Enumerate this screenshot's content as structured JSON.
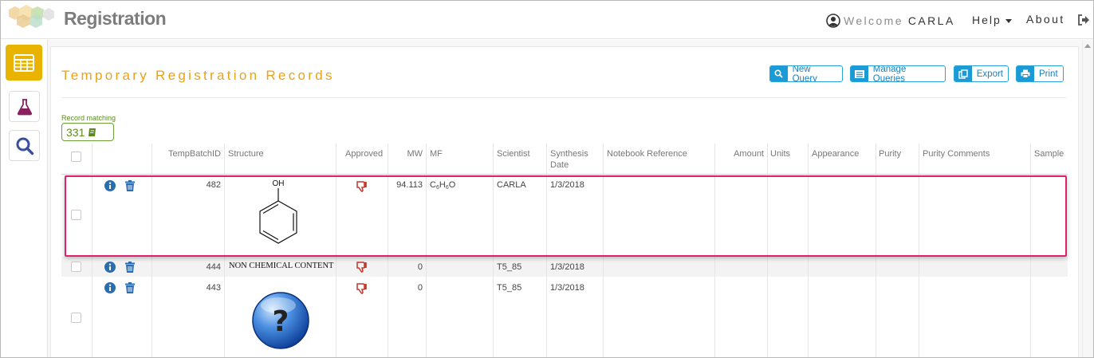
{
  "app": {
    "title": "Registration"
  },
  "header": {
    "welcome": "Welcome",
    "user": "CARLA",
    "help": "Help",
    "about": "About"
  },
  "sidebar": {
    "items": [
      {
        "name": "grid-icon",
        "active": true
      },
      {
        "name": "flask-icon",
        "active": false
      },
      {
        "name": "search-icon",
        "active": false
      }
    ]
  },
  "page": {
    "title": "Temporary Registration Records"
  },
  "toolbar": {
    "new_query": "New Query",
    "manage_queries": "Manage Queries",
    "export": "Export",
    "print": "Print"
  },
  "records": {
    "label": "Record matching",
    "count": "331"
  },
  "table": {
    "headers": {
      "tempbatchid": "TempBatchID",
      "structure": "Structure",
      "approved": "Approved",
      "mw": "MW",
      "mf": "MF",
      "scientist": "Scientist",
      "synthesis_date_1": "Synthesis",
      "synthesis_date_2": "Date",
      "notebook_reference": "Notebook Reference",
      "amount": "Amount",
      "units": "Units",
      "appearance": "Appearance",
      "purity": "Purity",
      "purity_comments": "Purity Comments",
      "sample": "Sample"
    },
    "rows": [
      {
        "tempbatchid": "482",
        "structure": "phenol",
        "structure_label": "OH",
        "mw": "94.113",
        "mf_c": "C",
        "mf_c_sub": "6",
        "mf_h": "H",
        "mf_h_sub": "6",
        "mf_o": "O",
        "scientist": "CARLA",
        "synthesis_date": "1/3/2018",
        "approved_icon": "thumbs-down-icon"
      },
      {
        "tempbatchid": "444",
        "structure_text": "NON CHEMICAL CONTENT",
        "mw": "0",
        "scientist": "T5_85",
        "synthesis_date": "1/3/2018",
        "approved_icon": "thumbs-down-icon"
      },
      {
        "tempbatchid": "443",
        "structure": "unknown",
        "structure_glyph": "?",
        "mw": "0",
        "scientist": "T5_85",
        "synthesis_date": "1/3/2018",
        "approved_icon": "thumbs-down-icon"
      }
    ]
  },
  "colors": {
    "accent_gold": "#e8b400",
    "title_orange": "#e8a317",
    "button_blue": "#1a9ad6",
    "record_green": "#6da034",
    "highlight_pink": "#e0206d",
    "thumb_red": "#c0392b",
    "icon_blue": "#2a6db0"
  }
}
